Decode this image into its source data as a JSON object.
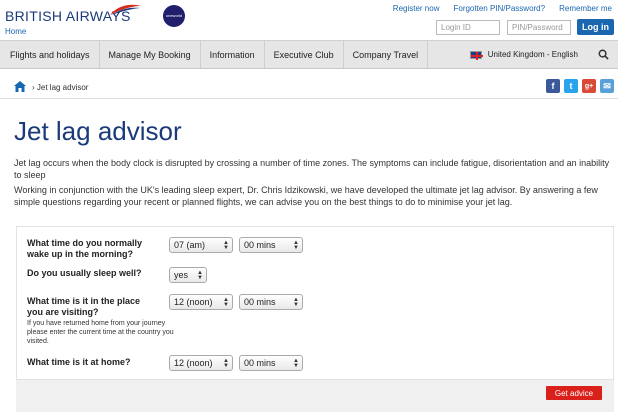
{
  "header": {
    "logo_text": "BRITISH AIRWAYS",
    "oneworld": "oneworld",
    "home_link": "Home",
    "top_links": [
      "Register now",
      "Forgotten PIN/Password?",
      "Remember me"
    ],
    "login_id_placeholder": "Login ID",
    "pin_placeholder": "PIN/Password",
    "login_button": "Log in"
  },
  "nav": {
    "items": [
      "Flights and holidays",
      "Manage My Booking",
      "Information",
      "Executive Club",
      "Company Travel"
    ],
    "region": "United Kingdom - English"
  },
  "breadcrumb": {
    "current": "Jet lag advisor"
  },
  "social": {
    "facebook": "f",
    "twitter": "t",
    "google": "g+",
    "email": "✉"
  },
  "page": {
    "title": "Jet lag advisor",
    "intro": "Jet lag occurs when the body clock is disrupted by crossing a number of time zones. The symptoms can include fatigue, disorientation and an inability to sleep",
    "intro2": "Working in conjunction with the UK's leading sleep expert, Dr. Chris Idzikowski, we have developed the ultimate jet lag advisor. By answering a few simple questions regarding your recent or planned flights, we can advise you on the best things to do to minimise your jet lag."
  },
  "form": {
    "q1_line1": "What time do you normally",
    "q1_line2": "wake up in the morning?",
    "q1_hour": "07 (am)",
    "q1_mins": "00 mins",
    "q2": "Do you usually sleep well?",
    "q2_value": "yes",
    "q3_line1": "What time is it in the place",
    "q3_line2": "you are visiting?",
    "q3_hint": "If you have returned home from your journey please enter the current time at the country you visited.",
    "q3_hour": "12 (noon)",
    "q3_mins": "00 mins",
    "q4": "What time is it at home?",
    "q4_hour": "12 (noon)",
    "q4_mins": "00 mins",
    "submit": "Get advice"
  },
  "colors": {
    "brand_blue": "#1b3a7a",
    "link_blue": "#1a67b0",
    "accent_red": "#d9201b"
  }
}
